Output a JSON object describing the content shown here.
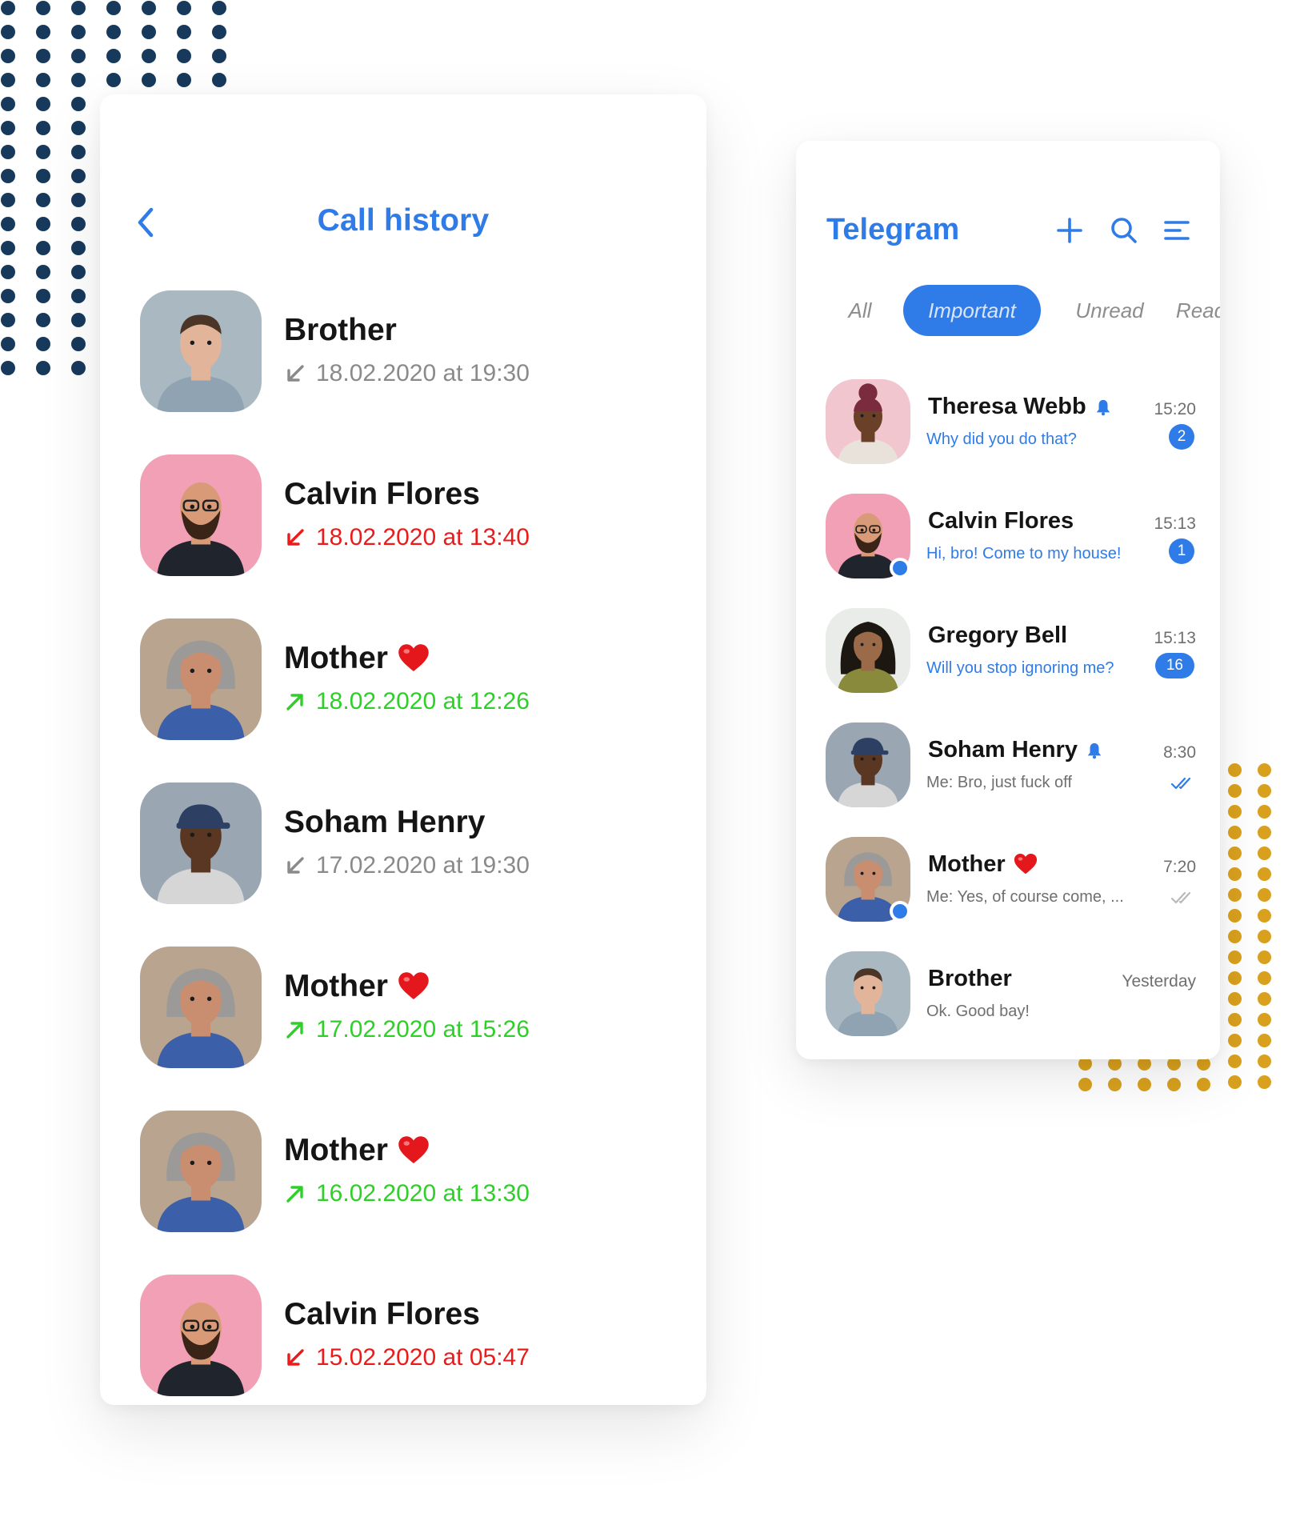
{
  "colors": {
    "accent": "#2f7be8",
    "missed": "#ec1b1b",
    "outgoing": "#2fcf2a",
    "incoming": "#8a8a8a",
    "dots_navy": "#17395c",
    "dots_gold": "#d9a11e"
  },
  "call_history": {
    "back_icon": "chevron-left-icon",
    "title": "Call history",
    "calls": [
      {
        "name": "Brother",
        "heart": false,
        "type": "incoming",
        "datetime": "18.02.2020 at 19:30",
        "avatar": "person-light-shirt"
      },
      {
        "name": "Calvin Flores",
        "heart": false,
        "type": "missed",
        "datetime": "18.02.2020 at 13:40",
        "avatar": "person-beard-pink-bg"
      },
      {
        "name": "Mother",
        "heart": true,
        "type": "outgoing",
        "datetime": "18.02.2020 at 12:26",
        "avatar": "person-grey-hair"
      },
      {
        "name": "Soham Henry",
        "heart": false,
        "type": "incoming",
        "datetime": "17.02.2020 at 19:30",
        "avatar": "person-blue-cap"
      },
      {
        "name": "Mother",
        "heart": true,
        "type": "outgoing",
        "datetime": "17.02.2020 at 15:26",
        "avatar": "person-grey-hair"
      },
      {
        "name": "Mother",
        "heart": true,
        "type": "outgoing",
        "datetime": "16.02.2020 at 13:30",
        "avatar": "person-grey-hair"
      },
      {
        "name": "Calvin Flores",
        "heart": false,
        "type": "missed",
        "datetime": "15.02.2020 at 05:47",
        "avatar": "person-beard-pink-bg"
      }
    ]
  },
  "telegram": {
    "title": "Telegram",
    "icons": {
      "add": "plus-icon",
      "search": "search-icon",
      "menu": "menu-icon"
    },
    "tabs": [
      {
        "label": "All",
        "active": false
      },
      {
        "label": "Important",
        "active": true
      },
      {
        "label": "Unread",
        "active": false
      },
      {
        "label": "Read",
        "active": false
      }
    ],
    "chats": [
      {
        "name": "Theresa Webb",
        "muted_icon": "bell-icon",
        "heart": false,
        "message": "Why did you do that?",
        "time": "15:20",
        "unread": "2",
        "status": "unread",
        "online": false,
        "avatar": "person-pink-bg"
      },
      {
        "name": "Calvin Flores",
        "heart": false,
        "message": "Hi, bro! Come to my house!",
        "time": "15:13",
        "unread": "1",
        "status": "unread",
        "online": true,
        "avatar": "person-beard-pink-bg"
      },
      {
        "name": "Gregory Bell",
        "heart": false,
        "message": "Will you stop ignoring me?",
        "time": "15:13",
        "unread": "16",
        "status": "unread",
        "online": false,
        "avatar": "person-curly-hair"
      },
      {
        "name": "Soham Henry",
        "muted_icon": "bell-icon",
        "heart": false,
        "message": "Me: Bro, just fuck off",
        "time": "8:30",
        "unread": "",
        "status": "read-blue",
        "online": false,
        "avatar": "person-blue-cap"
      },
      {
        "name": "Mother",
        "heart": true,
        "message": "Me: Yes, of course come, ...",
        "time": "7:20",
        "unread": "",
        "status": "read-grey",
        "online": true,
        "avatar": "person-grey-hair"
      },
      {
        "name": "Brother",
        "heart": false,
        "message": "Ok. Good bay!",
        "time": "Yesterday",
        "unread": "",
        "status": "none",
        "online": false,
        "avatar": "person-light-shirt"
      }
    ]
  }
}
